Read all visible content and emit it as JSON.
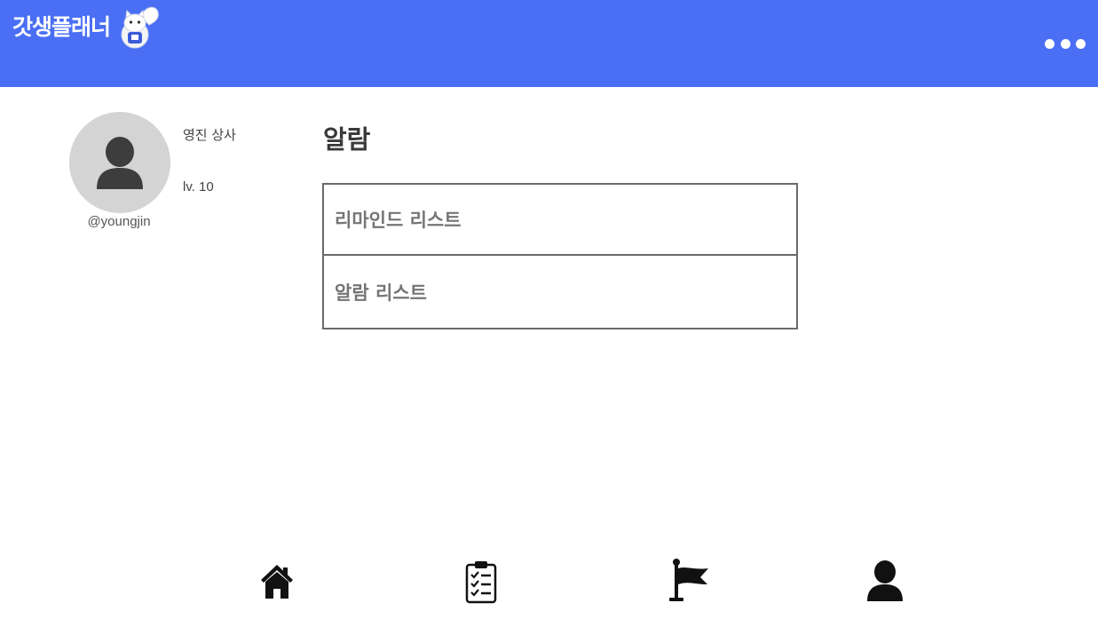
{
  "header": {
    "app_title": "갓생플래너",
    "background_color": "#4a6ff5",
    "icons": {
      "mascot": "squirrel-mascot-icon",
      "more": "more-dots-icon"
    }
  },
  "profile": {
    "display_name": "영진 상사",
    "level": "lv. 10",
    "username": "@youngjin",
    "avatar_icon": "user-avatar-icon"
  },
  "main": {
    "title": "알람",
    "menu": [
      {
        "label": "리마인드 리스트"
      },
      {
        "label": "알람 리스트"
      }
    ]
  },
  "bottom_nav": {
    "items": [
      {
        "icon": "home-icon"
      },
      {
        "icon": "clipboard-checklist-icon"
      },
      {
        "icon": "flag-icon"
      },
      {
        "icon": "user-icon"
      }
    ]
  }
}
